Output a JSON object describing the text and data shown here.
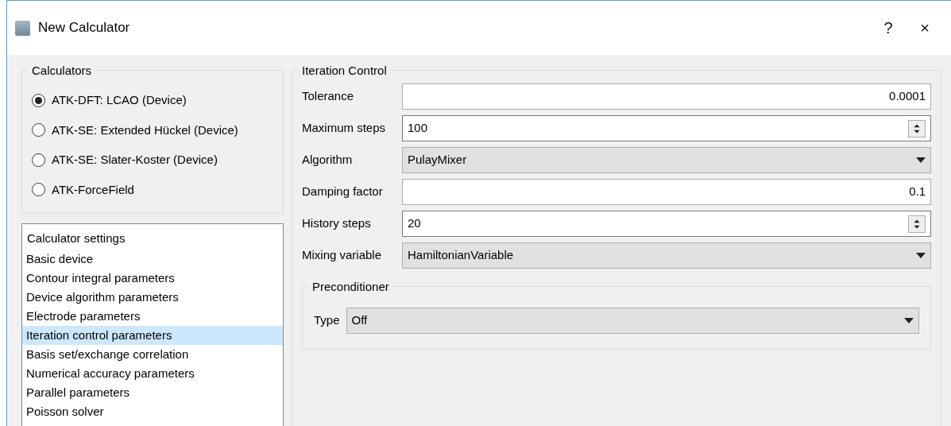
{
  "window": {
    "title": "New Calculator",
    "help": "?",
    "close": "×"
  },
  "calculators": {
    "title": "Calculators",
    "options": [
      {
        "label": "ATK-DFT: LCAO (Device)",
        "selected": true
      },
      {
        "label": "ATK-SE: Extended Hückel (Device)",
        "selected": false
      },
      {
        "label": "ATK-SE: Slater-Koster (Device)",
        "selected": false
      },
      {
        "label": "ATK-ForceField",
        "selected": false
      }
    ]
  },
  "settings": {
    "header": "Calculator settings",
    "items": [
      {
        "label": "Basic device",
        "selected": false
      },
      {
        "label": "Contour integral parameters",
        "selected": false
      },
      {
        "label": "Device algorithm parameters",
        "selected": false
      },
      {
        "label": "Electrode parameters",
        "selected": false
      },
      {
        "label": "Iteration control parameters",
        "selected": true
      },
      {
        "label": "Basis set/exchange correlation",
        "selected": false
      },
      {
        "label": "Numerical accuracy parameters",
        "selected": false
      },
      {
        "label": "Parallel parameters",
        "selected": false
      },
      {
        "label": "Poisson solver",
        "selected": false
      }
    ]
  },
  "iteration_control": {
    "title": "Iteration Control",
    "fields": [
      {
        "label": "Tolerance",
        "kind": "number",
        "value": "0.0001"
      },
      {
        "label": "Maximum steps",
        "kind": "spin",
        "value": "100"
      },
      {
        "label": "Algorithm",
        "kind": "combo",
        "value": "PulayMixer"
      },
      {
        "label": "Damping factor",
        "kind": "number",
        "value": "0.1"
      },
      {
        "label": "History steps",
        "kind": "spin",
        "value": "20"
      },
      {
        "label": "Mixing variable",
        "kind": "combo",
        "value": "HamiltonianVariable"
      }
    ],
    "preconditioner": {
      "title": "Preconditioner",
      "fields": [
        {
          "label": "Type",
          "kind": "combo",
          "value": "Off"
        }
      ]
    }
  }
}
